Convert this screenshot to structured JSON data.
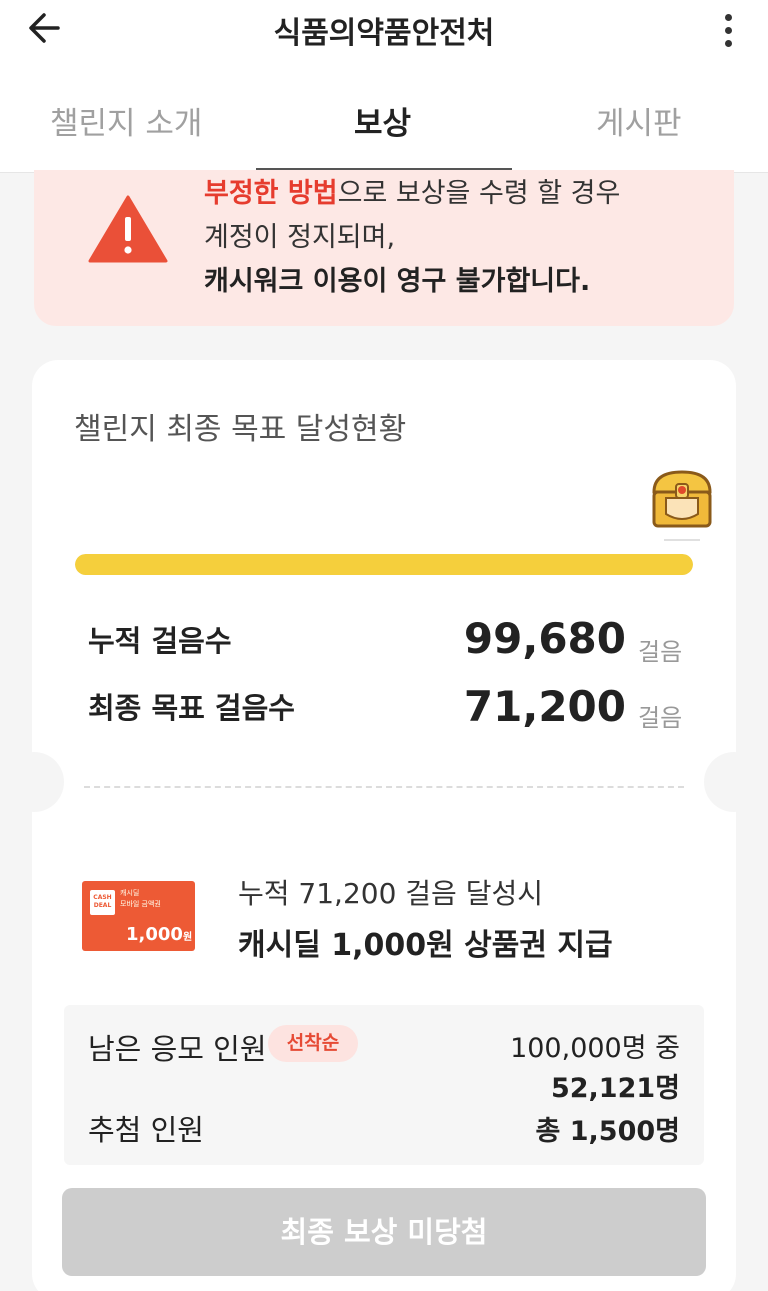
{
  "header": {
    "title": "식품의약품안전처",
    "back": "back-arrow-icon",
    "more": "more-vert-icon"
  },
  "tabs": [
    {
      "label": "챌린지 소개"
    },
    {
      "label": "보상",
      "selected": true
    },
    {
      "label": "게시판"
    }
  ],
  "warning": {
    "icon": "warning-icon",
    "line1_red": "부정한 방법",
    "line1_rest": "으로 보상을 수령 할 경우",
    "line2": "계정이 정지되며,",
    "line3": "캐시워크 이용이 영구 불가합니다."
  },
  "goal": {
    "title": "챌린지 최종 목표 달성현황",
    "chest_icon": "treasure-chest-icon",
    "progress": 1.0,
    "accum_label": "누적 걸음수",
    "accum_value": "99,680",
    "unit": "걸음",
    "final_label": "최종 목표 걸음수",
    "final_value": "71,200"
  },
  "reward": {
    "coupon": {
      "logo": "CASH DEAL",
      "desc_line1": "캐시딜",
      "desc_line2": "모바일 금액권",
      "amount": "1,000",
      "amount_unit": "원"
    },
    "line1": "누적 71,200 걸음 달성시",
    "line2": "캐시딜 1,000원 상품권 지급"
  },
  "applicants": {
    "remain_label": "남은 응모 인원",
    "badge": "선착순",
    "total": "100,000명 중",
    "remain": "52,121명",
    "winners_label": "추첨 인원",
    "winners": "총 1,500명"
  },
  "result_button": "최종 보상 미당첨",
  "colors": {
    "accent_red": "#e63c2e",
    "progress_yellow": "#f5cf3c",
    "warn_bg": "#fde8e5",
    "coupon_orange": "#ed5a35"
  }
}
